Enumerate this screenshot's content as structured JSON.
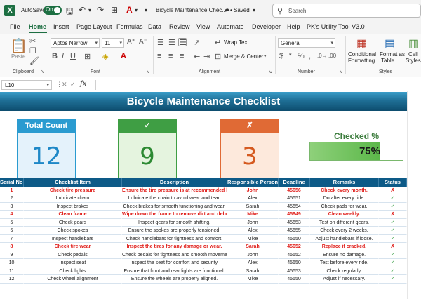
{
  "titlebar": {
    "logo_letter": "X",
    "autosave_label": "AutoSave",
    "autosave_state": "On",
    "doc_title": "Bicycle Maintenance Chec...",
    "saved_status": "• Saved",
    "search_placeholder": "Search"
  },
  "tabs": [
    "File",
    "Home",
    "Insert",
    "Page Layout",
    "Formulas",
    "Data",
    "Review",
    "View",
    "Automate",
    "Developer",
    "Help",
    "PK's Utility Tool V3.0"
  ],
  "active_tab": "Home",
  "ribbon": {
    "clipboard_label": "Clipboard",
    "paste_label": "Paste",
    "font_label": "Font",
    "font_name": "Aptos Narrow",
    "font_size": "11",
    "alignment_label": "Alignment",
    "wrap_text": "Wrap Text",
    "merge_center": "Merge & Center",
    "number_label": "Number",
    "number_format": "General",
    "styles_label": "Styles",
    "conditional_formatting": [
      "Conditional",
      "Formatting"
    ],
    "format_as_table": [
      "Format as",
      "Table"
    ],
    "cell_styles": [
      "Cell",
      "Styles"
    ]
  },
  "formula_bar": {
    "name_box": "L10",
    "fx": "fx",
    "formula": ""
  },
  "sheet": {
    "title": "Bicycle Maintenance Checklist",
    "cards": {
      "total": {
        "label": "Total Count",
        "value": "12"
      },
      "checked": {
        "label": "✓",
        "value": "9"
      },
      "unchecked": {
        "label": "✗",
        "value": "3"
      }
    },
    "checked_pct_label": "Checked %",
    "checked_pct_text": "75%",
    "checked_pct_value": 0.75
  },
  "table": {
    "headers": [
      "Serial No.",
      "Checklist Item",
      "Description",
      "Responsible Person",
      "Deadline",
      "Remarks",
      "Status"
    ],
    "rows": [
      {
        "sn": "1",
        "item": "Check tire pressure",
        "desc": "Ensure the tire pressure is at recommended levels",
        "resp": "John",
        "dead": "45656",
        "rem": "Check every month.",
        "status": "✗",
        "flag": true
      },
      {
        "sn": "2",
        "item": "Lubricate chain",
        "desc": "Lubricate the chain to avoid wear and tear.",
        "resp": "Alex",
        "dead": "45651",
        "rem": "Do after every ride.",
        "status": "✓",
        "flag": false
      },
      {
        "sn": "3",
        "item": "Inspect brakes",
        "desc": "Check brakes for smooth functioning and wear.",
        "resp": "Sarah",
        "dead": "45654",
        "rem": "Check pads for wear.",
        "status": "✓",
        "flag": false
      },
      {
        "sn": "4",
        "item": "Clean frame",
        "desc": "Wipe down the frame to remove dirt and debris.",
        "resp": "Mike",
        "dead": "45649",
        "rem": "Clean weekly.",
        "status": "✗",
        "flag": true
      },
      {
        "sn": "5",
        "item": "Check gears",
        "desc": "Inspect gears for smooth shifting.",
        "resp": "John",
        "dead": "45653",
        "rem": "Test on different gears.",
        "status": "✓",
        "flag": false
      },
      {
        "sn": "6",
        "item": "Check spokes",
        "desc": "Ensure the spokes are properly tensioned.",
        "resp": "Alex",
        "dead": "45655",
        "rem": "Check every 2 weeks.",
        "status": "✓",
        "flag": false
      },
      {
        "sn": "7",
        "item": "Inspect handlebars",
        "desc": "Check handlebars for tightness and comfort.",
        "resp": "Mike",
        "dead": "45650",
        "rem": "Adjust handlebars if loose.",
        "status": "✓",
        "flag": false
      },
      {
        "sn": "8",
        "item": "Check tire wear",
        "desc": "Inspect the tires for any damage or wear.",
        "resp": "Sarah",
        "dead": "45652",
        "rem": "Replace if cracked.",
        "status": "✗",
        "flag": true
      },
      {
        "sn": "9",
        "item": "Check pedals",
        "desc": "Check pedals for tightness and smooth movement",
        "resp": "John",
        "dead": "45652",
        "rem": "Ensure no damage.",
        "status": "✓",
        "flag": false
      },
      {
        "sn": "10",
        "item": "Inspect seat",
        "desc": "Inspect the seat for comfort and security.",
        "resp": "Alex",
        "dead": "45650",
        "rem": "Test before every ride.",
        "status": "✓",
        "flag": false
      },
      {
        "sn": "11",
        "item": "Check lights",
        "desc": "Ensure that front and rear lights are functional.",
        "resp": "Sarah",
        "dead": "45653",
        "rem": "Check regularly.",
        "status": "✓",
        "flag": false
      },
      {
        "sn": "12",
        "item": "Check wheel alignment",
        "desc": "Ensure the wheels are properly aligned.",
        "resp": "Mike",
        "dead": "45650",
        "rem": "Adjust if necessary.",
        "status": "✓",
        "flag": false
      }
    ]
  },
  "colors": {
    "excel_green": "#1d6f42",
    "header_blue": "#0d5a87",
    "total_blue": "#2a9bd0",
    "checked_green": "#3f9e44",
    "unchecked_orange": "#e06a35",
    "flag_red": "#e0201c"
  }
}
